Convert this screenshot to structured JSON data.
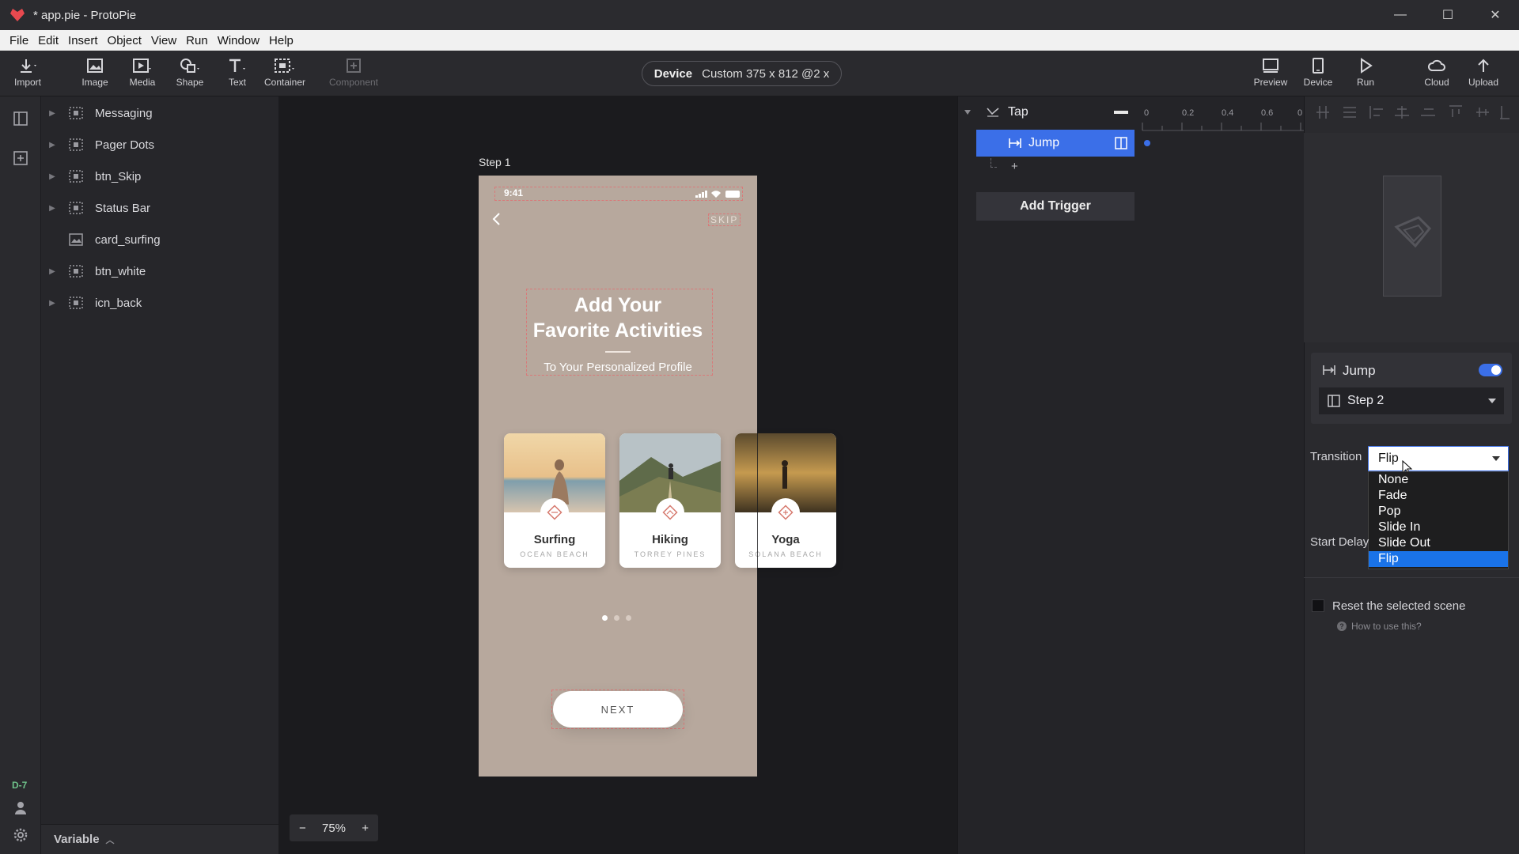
{
  "window": {
    "title": "* app.pie - ProtoPie",
    "controls": [
      "—",
      "☐",
      "✕"
    ]
  },
  "menu": [
    "File",
    "Edit",
    "Insert",
    "Object",
    "View",
    "Run",
    "Window",
    "Help"
  ],
  "toolbar": {
    "import": "Import",
    "image": "Image",
    "media": "Media",
    "shape": "Shape",
    "text": "Text",
    "container": "Container",
    "component": "Component",
    "device_label": "Device",
    "device_value": "Custom  375 x 812  @2 x",
    "preview": "Preview",
    "device": "Device",
    "run": "Run",
    "cloud": "Cloud",
    "upload": "Upload"
  },
  "left_rail": {
    "build": "D-7"
  },
  "layers": [
    {
      "name": "Messaging",
      "type": "container",
      "expandable": true
    },
    {
      "name": "Pager Dots",
      "type": "container",
      "expandable": true
    },
    {
      "name": "btn_Skip",
      "type": "container",
      "expandable": true
    },
    {
      "name": "Status Bar",
      "type": "container",
      "expandable": true
    },
    {
      "name": "card_surfing",
      "type": "image",
      "expandable": false
    },
    {
      "name": "btn_white",
      "type": "container",
      "expandable": true
    },
    {
      "name": "icn_back",
      "type": "container",
      "expandable": true
    }
  ],
  "variable_bar": "Variable",
  "canvas": {
    "step": "Step 1",
    "zoom": {
      "minus": "−",
      "value": "75%",
      "plus": "+"
    },
    "phone": {
      "time": "9:41",
      "skip": "SKIP",
      "title_line1": "Add Your",
      "title_line2": "Favorite Activities",
      "subtitle": "To Your Personalized Profile",
      "next": "NEXT",
      "cards": [
        {
          "title": "Surfing",
          "subtitle": "OCEAN BEACH"
        },
        {
          "title": "Hiking",
          "subtitle": "TORREY PINES"
        },
        {
          "title": "Yoga",
          "subtitle": "SOLANA BEACH"
        }
      ]
    }
  },
  "interactions": {
    "trigger": "Tap",
    "response": "Jump",
    "add_trigger": "Add Trigger",
    "add_symbol": "+",
    "ruler": [
      "0",
      "0.2",
      "0.4",
      "0.6",
      "0"
    ]
  },
  "props": {
    "jump_title": "Jump",
    "jump_enabled": true,
    "target": "Step 2",
    "transition_label": "Transition",
    "transition_value": "Flip",
    "transition_options": [
      "None",
      "Fade",
      "Pop",
      "Slide In",
      "Slide Out",
      "Flip"
    ],
    "start_delay": "Start Delay",
    "reset_label": "Reset the selected scene",
    "how_to": "How to use this?"
  },
  "colors": {
    "accent": "#3b6fe8",
    "phone_bg": "#b7a89d",
    "selected_option": "#1a73e8"
  }
}
